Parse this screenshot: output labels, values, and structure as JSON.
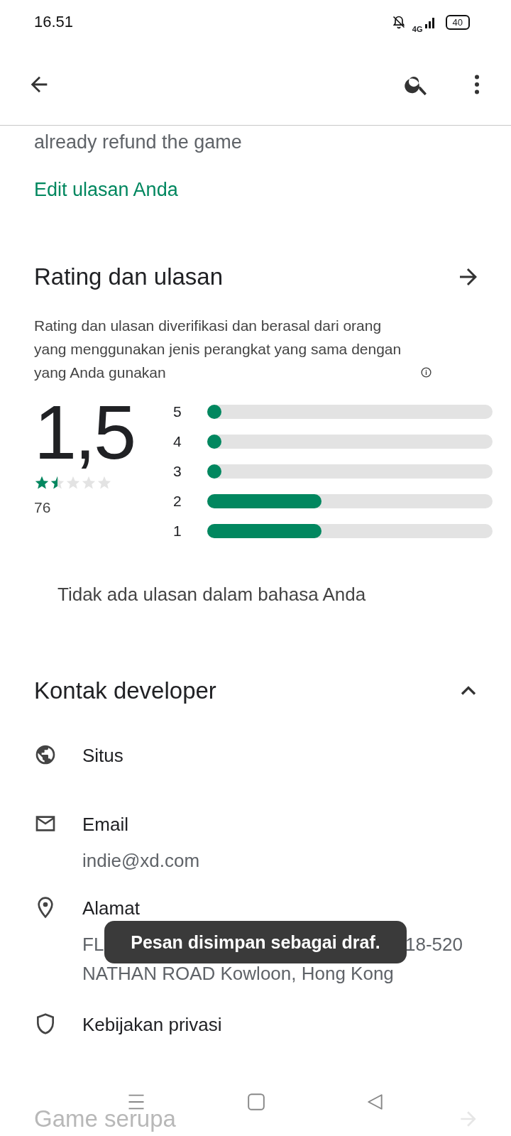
{
  "status_bar": {
    "time": "16.51",
    "network": "4G",
    "battery": "40"
  },
  "review_tail": {
    "text": "already refund the game",
    "edit_link": "Edit ulasan Anda"
  },
  "ratings": {
    "title": "Rating dan ulasan",
    "description": "Rating dan ulasan diverifikasi dan berasal dari orang yang menggunakan jenis perangkat yang sama dengan yang Anda gunakan",
    "score": "1,5",
    "stars": 1.5,
    "count": "76",
    "bars": [
      {
        "label": "5",
        "level": 0.02
      },
      {
        "label": "4",
        "level": 0.02
      },
      {
        "label": "3",
        "level": 0.02
      },
      {
        "label": "2",
        "level": 0.4
      },
      {
        "label": "1",
        "level": 0.4
      }
    ],
    "empty_note": "Tidak ada ulasan dalam bahasa Anda"
  },
  "developer_contact": {
    "title": "Kontak developer",
    "expanded": true,
    "items": [
      {
        "kind": "web",
        "title": "Situs"
      },
      {
        "kind": "email",
        "title": "Email",
        "lines": [
          [
            "indie@xd.com"
          ]
        ]
      },
      {
        "kind": "address",
        "title": "Alamat",
        "lines": [
          [
            "FL",
            "18-520"
          ],
          [
            "NATHAN ROAD Kowloon, Hong Kong"
          ]
        ]
      },
      {
        "kind": "privacy",
        "title": "Kebijakan privasi"
      }
    ]
  },
  "similar": {
    "title": "Game serupa"
  },
  "toast": {
    "text": "Pesan disimpan sebagai draf."
  }
}
